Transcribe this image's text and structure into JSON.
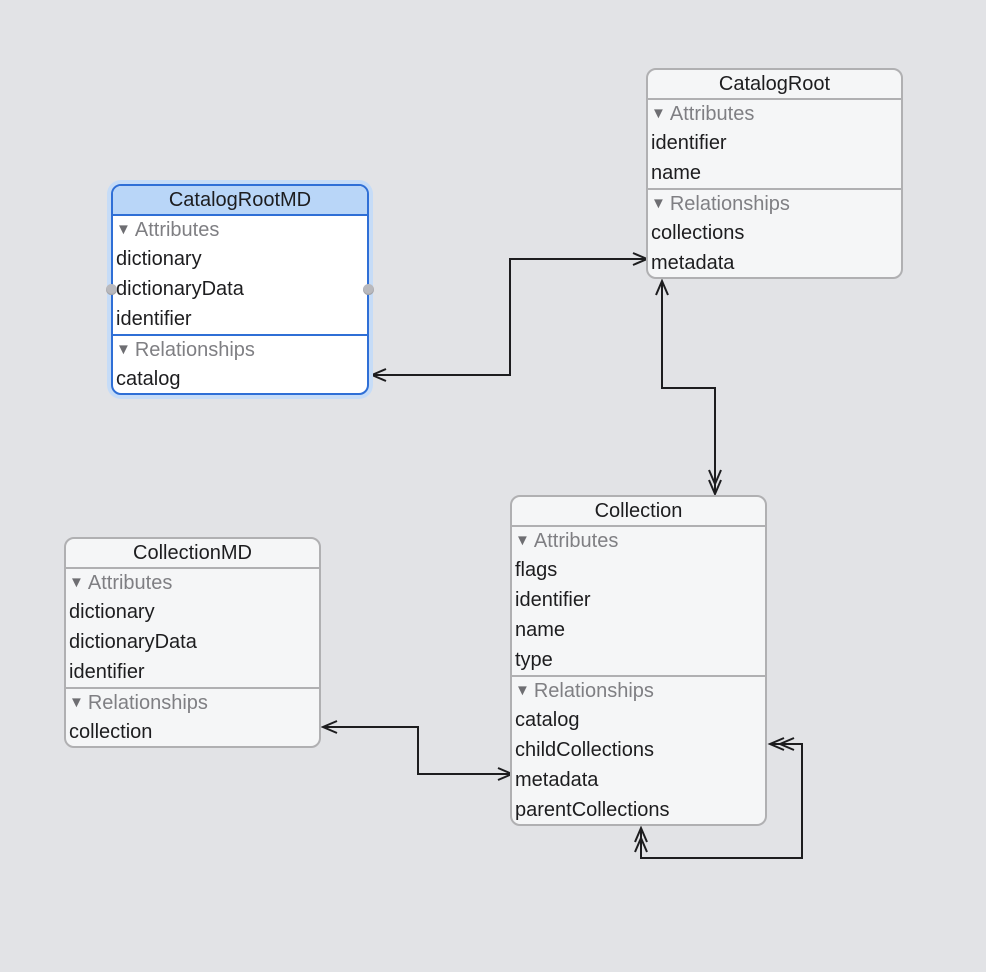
{
  "entities": {
    "catalog_root_md": {
      "name": "CatalogRootMD",
      "selected": true,
      "attributes_label": "Attributes",
      "relationships_label": "Relationships",
      "attributes": [
        "dictionary",
        "dictionaryData",
        "identifier"
      ],
      "relationships": [
        "catalog"
      ]
    },
    "catalog_root": {
      "name": "CatalogRoot",
      "selected": false,
      "attributes_label": "Attributes",
      "relationships_label": "Relationships",
      "attributes": [
        "identifier",
        "name"
      ],
      "relationships": [
        "collections",
        "metadata"
      ]
    },
    "collection": {
      "name": "Collection",
      "selected": false,
      "attributes_label": "Attributes",
      "relationships_label": "Relationships",
      "attributes": [
        "flags",
        "identifier",
        "name",
        "type"
      ],
      "relationships": [
        "catalog",
        "childCollections",
        "metadata",
        "parentCollections"
      ]
    },
    "collection_md": {
      "name": "CollectionMD",
      "selected": false,
      "attributes_label": "Attributes",
      "relationships_label": "Relationships",
      "attributes": [
        "dictionary",
        "dictionaryData",
        "identifier"
      ],
      "relationships": [
        "collection"
      ]
    }
  },
  "disclosure_icon": "▼",
  "relationships": [
    {
      "from": "CatalogRootMD.catalog",
      "to": "CatalogRoot.metadata",
      "from_cardinality": "to-one",
      "to_cardinality": "to-one"
    },
    {
      "from": "CatalogRoot.collections",
      "to": "Collection.catalog",
      "from_cardinality": "to-many",
      "to_cardinality": "to-one"
    },
    {
      "from": "CollectionMD.collection",
      "to": "Collection.metadata",
      "from_cardinality": "to-one",
      "to_cardinality": "to-one"
    },
    {
      "from": "Collection.childCollections",
      "to": "Collection.parentCollections",
      "from_cardinality": "to-many",
      "to_cardinality": "to-many"
    }
  ],
  "colors": {
    "canvas": "#e2e3e6",
    "entity_border": "#b0b0b2",
    "selection_border": "#2f6fd6",
    "selection_header": "#b9d6f8",
    "connector": "#1d1d1f"
  }
}
